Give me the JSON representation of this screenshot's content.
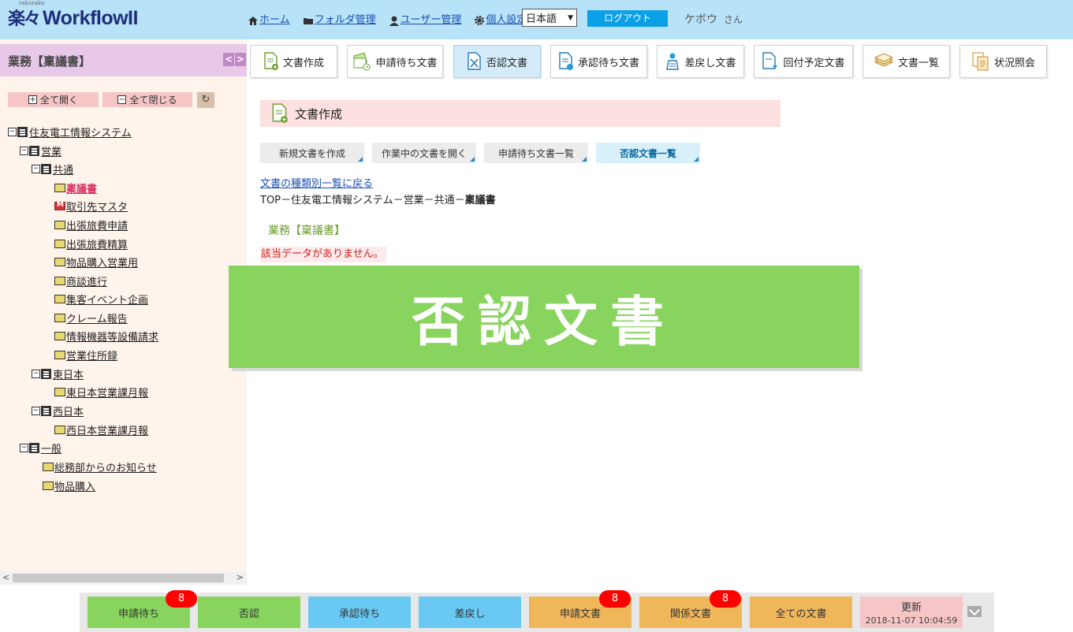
{
  "header": {
    "logo_raku": "楽々",
    "logo_raku_small": "rakuraku",
    "logo_workflow": "WorkflowII",
    "nav": [
      {
        "label": "ホーム",
        "icon": "home-icon"
      },
      {
        "label": "フォルダ管理",
        "icon": "folder-icon"
      },
      {
        "label": "ユーザー管理",
        "icon": "user-icon"
      },
      {
        "label": "個人設定",
        "icon": "gear-icon"
      }
    ],
    "language": "日本語",
    "logout": "ログアウト",
    "user_name": "ケボウ",
    "user_suffix": "さん"
  },
  "sidebar": {
    "title": "業務【稟議書】",
    "expand_all": "全て開く",
    "collapse_all": "全て閉じる",
    "tree": [
      {
        "label": "住友電工情報システム",
        "type": "db"
      },
      {
        "label": "営業",
        "type": "db"
      },
      {
        "label": "共通",
        "type": "db"
      },
      {
        "label": "稟議書",
        "type": "folder",
        "active": true
      },
      {
        "label": "取引先マスタ",
        "type": "mail"
      },
      {
        "label": "出張旅費申請",
        "type": "folder"
      },
      {
        "label": "出張旅費精算",
        "type": "folder"
      },
      {
        "label": "物品購入営業用",
        "type": "folder"
      },
      {
        "label": "商談進行",
        "type": "folder"
      },
      {
        "label": "集客イベント企画",
        "type": "folder"
      },
      {
        "label": "クレーム報告",
        "type": "folder"
      },
      {
        "label": "情報機器等設備請求",
        "type": "folder"
      },
      {
        "label": "営業住所録",
        "type": "folder"
      },
      {
        "label": "東日本",
        "type": "db"
      },
      {
        "label": "東日本営業課月報",
        "type": "folder"
      },
      {
        "label": "西日本",
        "type": "db"
      },
      {
        "label": "西日本営業課月報",
        "type": "folder"
      },
      {
        "label": "一般",
        "type": "db"
      },
      {
        "label": "総務部からのお知らせ",
        "type": "folder"
      },
      {
        "label": "物品購入",
        "type": "folder"
      }
    ]
  },
  "toolbar": [
    {
      "label": "文書作成",
      "icon": "doc-create-icon"
    },
    {
      "label": "申請待ち文書",
      "icon": "doc-pending-icon"
    },
    {
      "label": "否認文書",
      "icon": "doc-rejected-icon",
      "active": true
    },
    {
      "label": "承認待ち文書",
      "icon": "doc-approval-icon"
    },
    {
      "label": "差戻し文書",
      "icon": "doc-returned-icon"
    },
    {
      "label": "回付予定文書",
      "icon": "doc-circulate-icon"
    },
    {
      "label": "文書一覧",
      "icon": "doc-list-icon"
    },
    {
      "label": "状況照会",
      "icon": "status-inquiry-icon"
    }
  ],
  "main": {
    "section_title": "文書作成",
    "subtabs": [
      {
        "label": "新規文書を作成"
      },
      {
        "label": "作業中の文書を開く"
      },
      {
        "label": "申請待ち文書一覧"
      },
      {
        "label": "否認文書一覧",
        "active": true
      }
    ],
    "back_link": "文書の種類別一覧に戻る",
    "breadcrumb_path": "TOP－住友電工情報システム－営業－共通－",
    "breadcrumb_current": "稟議書",
    "doc_type": "業務【稟議書】",
    "no_data": "該当データがありません。",
    "banner": "否認文書"
  },
  "bottombar": {
    "buttons": [
      {
        "label": "申請待ち",
        "color": "green",
        "badge": "8"
      },
      {
        "label": "否認",
        "color": "green"
      },
      {
        "label": "承認待ち",
        "color": "blue"
      },
      {
        "label": "差戻し",
        "color": "blue"
      },
      {
        "label": "申請文書",
        "color": "orange",
        "badge": "8"
      },
      {
        "label": "関係文書",
        "color": "orange",
        "badge": "8"
      },
      {
        "label": "全ての文書",
        "color": "orange"
      }
    ],
    "refresh_label": "更新",
    "refresh_time": "2018-11-07 10:04:59"
  },
  "colors": {
    "header_bg": "#b8e2f8",
    "sidebar_title_bg": "#e8c8e8",
    "banner_bg": "#88d45e",
    "logout_bg": "#0aa0e6"
  }
}
